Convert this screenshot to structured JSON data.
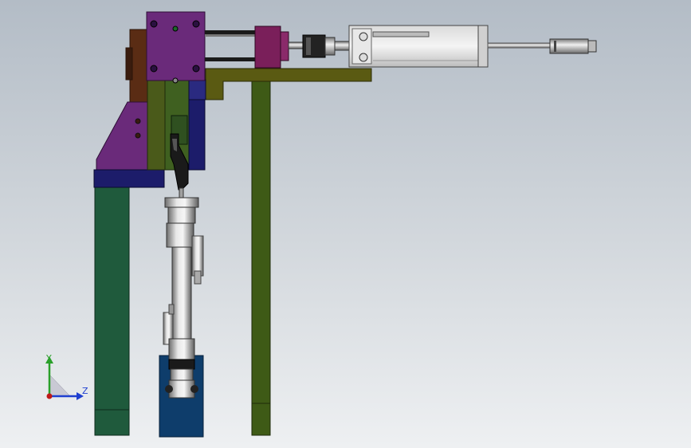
{
  "triad": {
    "y_label": "Y",
    "z_label": "Z"
  },
  "colors": {
    "background_top": "#b3bcc6",
    "background_bottom": "#eef0f2",
    "green_leg": "#1f5a3c",
    "olive_plate": "#5a5a12",
    "olive_post": "#3e5a16",
    "purple_block": "#6a2a7a",
    "navy_block": "#1c1c6a",
    "brown_block": "#5a2c14",
    "teal_block": "#0e3d6b",
    "steel": "#c8c8c8",
    "magenta_clamp": "#7a1f5a",
    "axis_y": "#2aa02a",
    "axis_z": "#1f3fd0",
    "origin": "#c01818"
  },
  "icons": {
    "triad": "coordinate-axes-icon"
  }
}
